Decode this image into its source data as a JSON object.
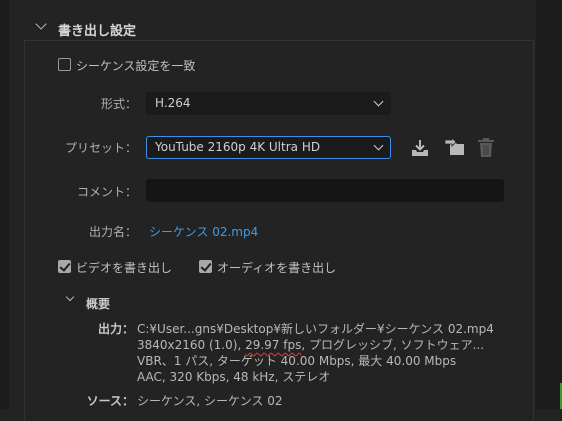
{
  "section": {
    "title": "書き出し設定"
  },
  "match_sequence": {
    "label": "シーケンス設定を一致",
    "checked": false
  },
  "format": {
    "label": "形式：",
    "value": "H.264"
  },
  "preset": {
    "label": "プリセット：",
    "value": "YouTube 2160p 4K Ultra HD"
  },
  "comment": {
    "label": "コメント：",
    "value": ""
  },
  "output_name": {
    "label": "出力名：",
    "value": "シーケンス 02.mp4"
  },
  "export_video": {
    "label": "ビデオを書き出し",
    "checked": true
  },
  "export_audio": {
    "label": "オーディオを書き出し",
    "checked": true
  },
  "summary": {
    "title": "概要",
    "output_label": "出力：",
    "output_path": "C:¥User...gns¥Desktop¥新しいフォルダー¥シーケンス 02.mp4",
    "output_res": "3840x2160 (1.0), ",
    "output_fps": "29.97 fps",
    "output_rest": ", プログレッシブ, ソフトウェア...",
    "output_bitrate": "VBR、1 パス, ターゲット 40.00 Mbps, 最大 40.00 Mbps",
    "output_audio": "AAC, 320 Kbps, 48 kHz, ステレオ",
    "source_label": "ソース：",
    "source_value": "シーケンス, シーケンス 02"
  },
  "icons": {
    "save_preset": "download-tray-icon",
    "import_preset": "folder-import-icon",
    "delete_preset": "trash-icon"
  },
  "colors": {
    "background": "#232323",
    "link": "#3e9ce8",
    "focus_border": "#3d8fe8",
    "spellcheck_underline": "#d43030"
  }
}
